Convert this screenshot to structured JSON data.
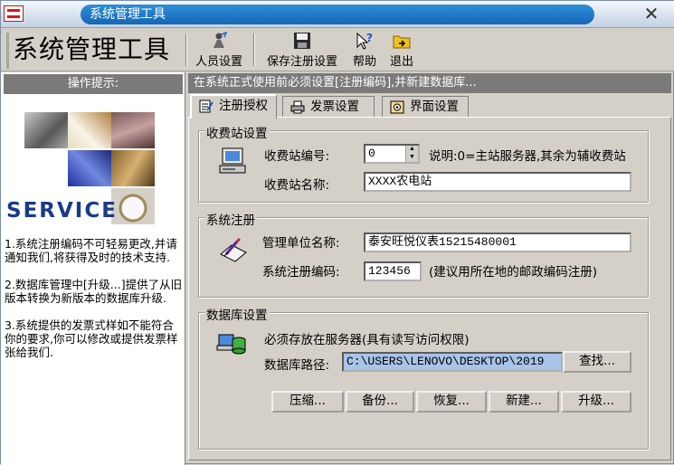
{
  "window": {
    "title": "系统管理工具",
    "close_glyph": "✕"
  },
  "header": {
    "app_title": "系统管理工具",
    "toolbar": [
      {
        "label": "人员设置",
        "icon": "people-settings-icon"
      },
      {
        "label": "保存注册设置",
        "icon": "save-icon"
      },
      {
        "label": "帮助",
        "icon": "help-icon"
      },
      {
        "label": "退出",
        "icon": "exit-icon"
      }
    ]
  },
  "left_panel": {
    "heading": "操作提示:",
    "service_text": "SERVICE",
    "tips": [
      "1.系统注册编码不可轻易更改,并请通知我们,将获得及时的技术支持.",
      "2.数据库管理中[升级...]提供了从旧版本转换为新版本的数据库升级.",
      "3.系统提供的发票式样如不能符合你的要求,你可以修改或提供发票样张给我们."
    ]
  },
  "main": {
    "notice": "在系统正式使用前必须设置[注册编码],并新建数据库...",
    "tabs": [
      {
        "label": "注册授权",
        "active": true
      },
      {
        "label": "发票设置",
        "active": false
      },
      {
        "label": "界面设置",
        "active": false
      }
    ],
    "station": {
      "title": "收费站设置",
      "number_label": "收费站编号:",
      "number_value": "0",
      "number_hint": "说明:0=主站服务器,其余为辅收费站",
      "name_label": "收费站名称:",
      "name_value": "XXXX农电站"
    },
    "registration": {
      "title": "系统注册",
      "unit_label": "管理单位名称:",
      "unit_value": "泰安旺悦仪表15215480001",
      "code_label": "系统注册编码:",
      "code_value": "123456",
      "code_hint": "(建议用所在地的邮政编码注册)"
    },
    "database": {
      "title": "数据库设置",
      "note": "必须存放在服务器(具有读写访问权限)",
      "path_label": "数据库路径:",
      "path_value": "C:\\USERS\\LENOVO\\DESKTOP\\2019",
      "find_button": "查找...",
      "buttons": [
        "压缩...",
        "备份...",
        "恢复...",
        "新建...",
        "升级..."
      ]
    }
  }
}
